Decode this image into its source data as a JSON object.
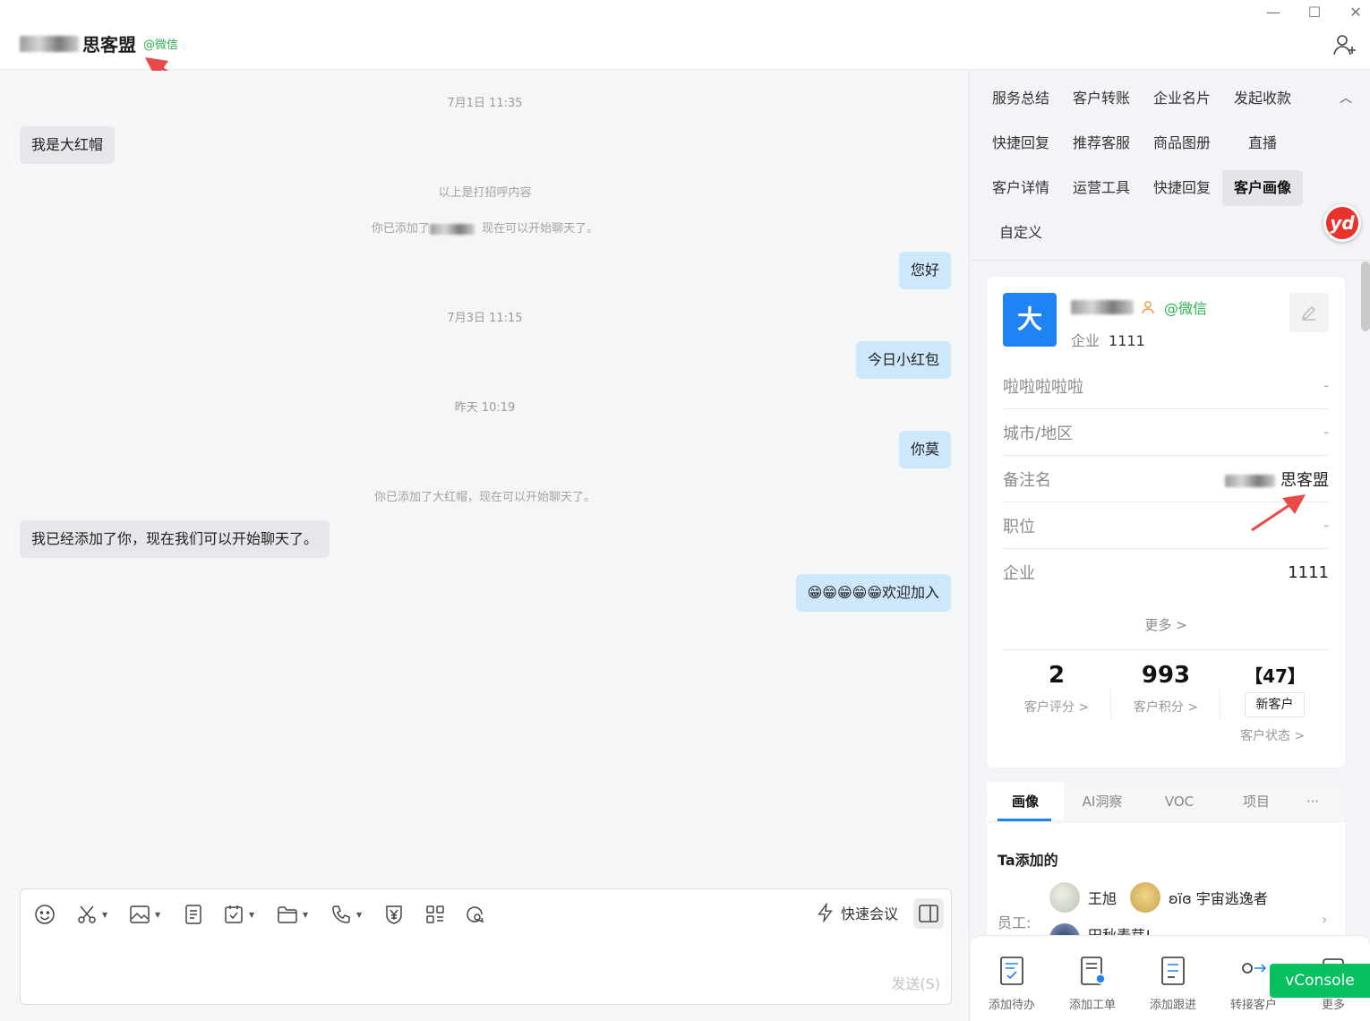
{
  "header": {
    "title": "思客盟",
    "source": "@微信",
    "window_controls": [
      "minimize-icon",
      "maximize-icon",
      "close-icon"
    ],
    "add_user_icon": "add-user-icon"
  },
  "chat": {
    "items": [
      {
        "kind": "time",
        "text": "7月1日 11:35"
      },
      {
        "kind": "msg",
        "side": "left",
        "text": "我是大红帽"
      },
      {
        "kind": "sys",
        "text": "以上是打招呼内容"
      },
      {
        "kind": "sys",
        "text_before": "你已添加了",
        "text_after": "现在可以开始聊天了。"
      },
      {
        "kind": "msg",
        "side": "right",
        "text": "您好"
      },
      {
        "kind": "time",
        "text": "7月3日 11:15"
      },
      {
        "kind": "msg",
        "side": "right",
        "text": "今日小红包"
      },
      {
        "kind": "time",
        "text": "昨天 10:19"
      },
      {
        "kind": "msg",
        "side": "right",
        "text": "你莫"
      },
      {
        "kind": "sys",
        "text": "你已添加了大红帽，现在可以开始聊天了。"
      },
      {
        "kind": "msg",
        "side": "left",
        "text": "我已经添加了你，现在我们可以开始聊天了。"
      },
      {
        "kind": "msg",
        "side": "right",
        "text": "😁😁😁😁😁欢迎加入"
      }
    ]
  },
  "composer": {
    "tools": [
      "emoji-icon",
      "scissors-icon",
      "image-icon",
      "document-icon",
      "calendar-check-icon",
      "folder-icon",
      "phone-icon",
      "yuan-icon",
      "grid-icon",
      "chat-search-icon"
    ],
    "quick_meeting": "快速会议",
    "send": "发送(S)"
  },
  "panel": {
    "tabs": [
      [
        "服务总结",
        "客户转账",
        "企业名片",
        "发起收款"
      ],
      [
        "快捷回复",
        "推荐客服",
        "商品图册",
        "直播"
      ],
      [
        "客户详情",
        "运营工具",
        "快捷回复",
        "客户画像"
      ],
      [
        "自定义"
      ]
    ],
    "active_tab": "客户画像",
    "yd_badge": "yd",
    "customer": {
      "avatar": "大",
      "source": "@微信",
      "corp_label": "企业",
      "corp_value": "1111",
      "fields": [
        {
          "key": "啦啦啦啦啦",
          "value": "-"
        },
        {
          "key": "城市/地区",
          "value": "-"
        },
        {
          "key": "备注名",
          "value": "思客盟"
        },
        {
          "key": "职位",
          "value": "-"
        },
        {
          "key": "企业",
          "value": "1111"
        }
      ],
      "more": "更多 >",
      "stats": [
        {
          "value": "2",
          "label": "客户评分 >"
        },
        {
          "value": "993",
          "label": "客户积分 >"
        },
        {
          "value": "【47】",
          "label": "新客户"
        }
      ],
      "status_label": "客户状态 >"
    },
    "subtabs": [
      "画像",
      "AI洞察",
      "VOC",
      "项目",
      "···"
    ],
    "ta_title": "Ta添加的",
    "employee_label": "员工:",
    "employees": [
      "王旭",
      "ʚïɞ 宇宙逃逸者",
      "田秋麦芽!"
    ],
    "bottom_actions": [
      "添加待办",
      "添加工单",
      "添加跟进",
      "转接客户",
      "更多"
    ],
    "vconsole": "vConsole"
  }
}
